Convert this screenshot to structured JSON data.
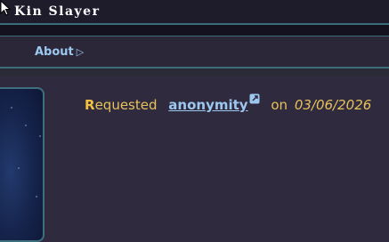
{
  "window": {
    "title": "Kin Slayer"
  },
  "nav": {
    "about_label": "About"
  },
  "entry": {
    "requested_cap": "R",
    "requested_rest": "equested",
    "username": "anonymity",
    "on_label": "on",
    "date": "03/06/2026"
  },
  "colors": {
    "background": "#2f2a3e",
    "titlebar": "#1e1b2b",
    "border_accent": "#3c6c7a",
    "link": "#9cc8f0",
    "gold": "#e7c15b"
  }
}
